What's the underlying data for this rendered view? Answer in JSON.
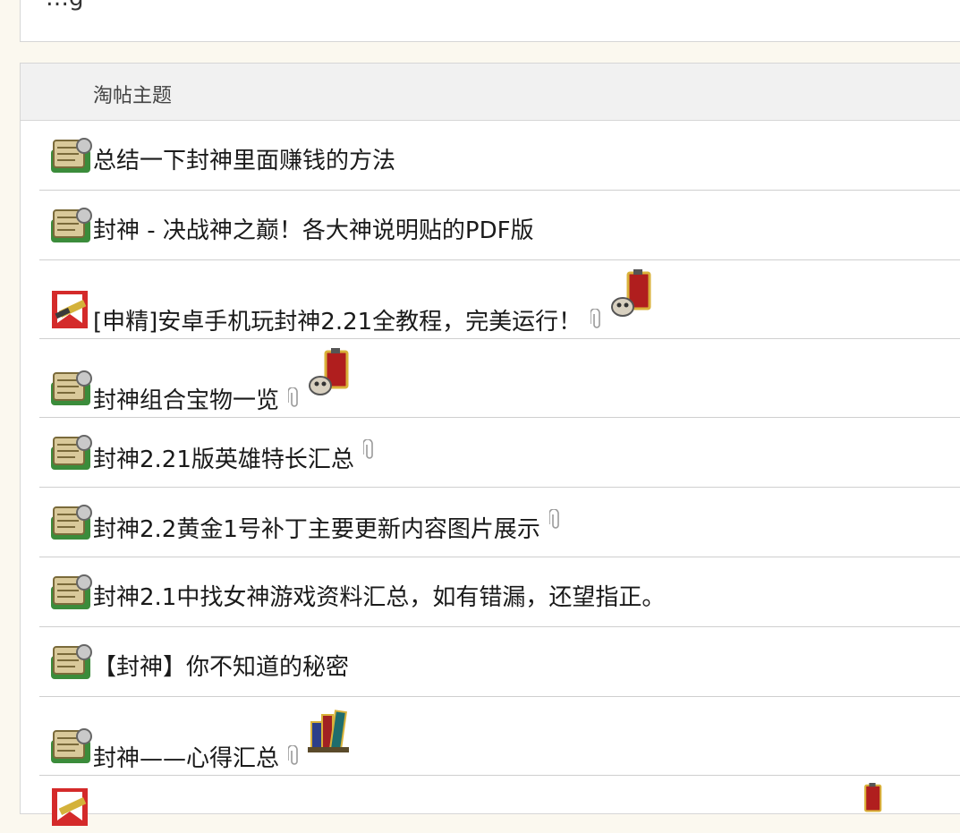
{
  "top_box": {
    "visible_text": "…g"
  },
  "panel": {
    "header_title": "淘帖主题",
    "threads": [
      {
        "title": "总结一下封神里面赚钱的方法",
        "icon": "scroll-icon",
        "attachment": false,
        "reward": null
      },
      {
        "title": "封神 - 决战神之巅！各大神说明贴的PDF版",
        "icon": "scroll-icon",
        "attachment": false,
        "reward": null
      },
      {
        "title": "[申精]安卓手机玩封神2.21全教程，完美运行！",
        "icon": "banner-icon",
        "attachment": true,
        "reward": "lantern-skull-icon"
      },
      {
        "title": "封神组合宝物一览",
        "icon": "scroll-icon",
        "attachment": true,
        "reward": "lantern-skull-icon"
      },
      {
        "title": "封神2.21版英雄特长汇总",
        "icon": "scroll-icon",
        "attachment": true,
        "reward": null
      },
      {
        "title": "封神2.2黄金1号补丁主要更新内容图片展示",
        "icon": "scroll-icon",
        "attachment": true,
        "reward": null
      },
      {
        "title": "封神2.1中找女神游戏资料汇总，如有错漏，还望指正。",
        "icon": "scroll-icon",
        "attachment": false,
        "reward": null
      },
      {
        "title": "【封神】你不知道的秘密",
        "icon": "scroll-icon",
        "attachment": false,
        "reward": null
      },
      {
        "title": "封神——心得汇总",
        "icon": "scroll-icon",
        "attachment": true,
        "reward": "books-icon"
      },
      {
        "title": "",
        "icon": "banner-icon",
        "attachment": false,
        "reward": "lantern-skull-icon"
      }
    ]
  },
  "colors": {
    "page_bg": "#fbf8ef",
    "header_bg": "#f1f1f1",
    "divider": "#cfcfcf"
  }
}
